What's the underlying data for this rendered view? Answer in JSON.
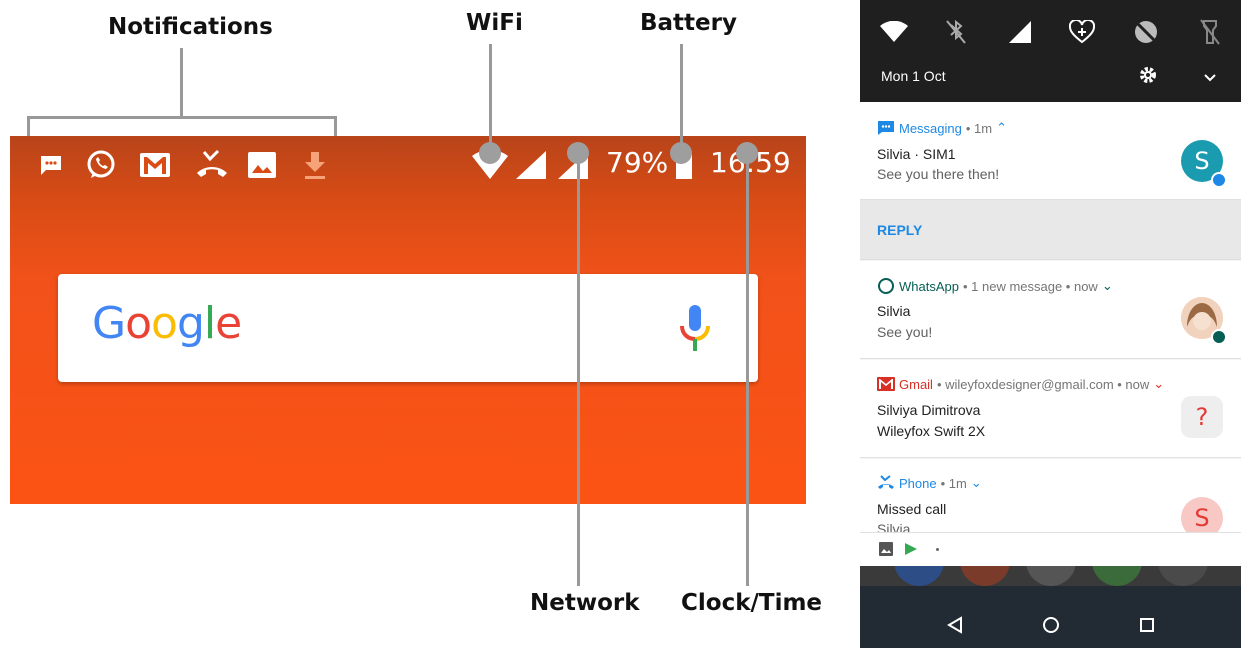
{
  "callouts": {
    "notifications": "Notifications",
    "wifi": "WiFi",
    "battery": "Battery",
    "network": "Network",
    "clock": "Clock/Time"
  },
  "status_bar": {
    "battery_percent": "79%",
    "time": "16:59",
    "notification_icons": [
      "messaging-icon",
      "whatsapp-icon",
      "gmail-icon",
      "missed-call-icon",
      "image-icon",
      "download-icon"
    ]
  },
  "search": {
    "logo": "Google",
    "mic_icon": "microphone-icon"
  },
  "shade": {
    "date": "Mon 1 Oct",
    "quick_settings": [
      "wifi-icon",
      "bluetooth-off-icon",
      "signal-icon",
      "data-saver-icon",
      "do-not-disturb-icon",
      "flashlight-off-icon"
    ],
    "notifications": [
      {
        "app": "Messaging",
        "meta": "• 1m",
        "title": "Silvia · SIM1",
        "text": "See you there then!",
        "avatar": "S",
        "app_color": "#1e88e5"
      },
      {
        "app": "WhatsApp",
        "meta": "• 1 new message • now",
        "title": "Silvia",
        "text": "See you!",
        "app_color": "#075e54"
      },
      {
        "app": "Gmail",
        "meta": "• wileyfoxdesigner@gmail.com • now",
        "title": "Silviya Dimitrova",
        "text": "Wileyfox Swift 2X",
        "avatar": "?",
        "app_color": "#d93025"
      },
      {
        "app": "Phone",
        "meta": "• 1m",
        "title": "Missed call",
        "text": "Silvia",
        "avatar": "S",
        "app_color": "#1e88e5"
      }
    ],
    "reply_label": "REPLY",
    "colors": {
      "accent": "#1e88e5",
      "phone_orange": "#fb5314",
      "shade_dark": "#1f1f1f"
    }
  }
}
